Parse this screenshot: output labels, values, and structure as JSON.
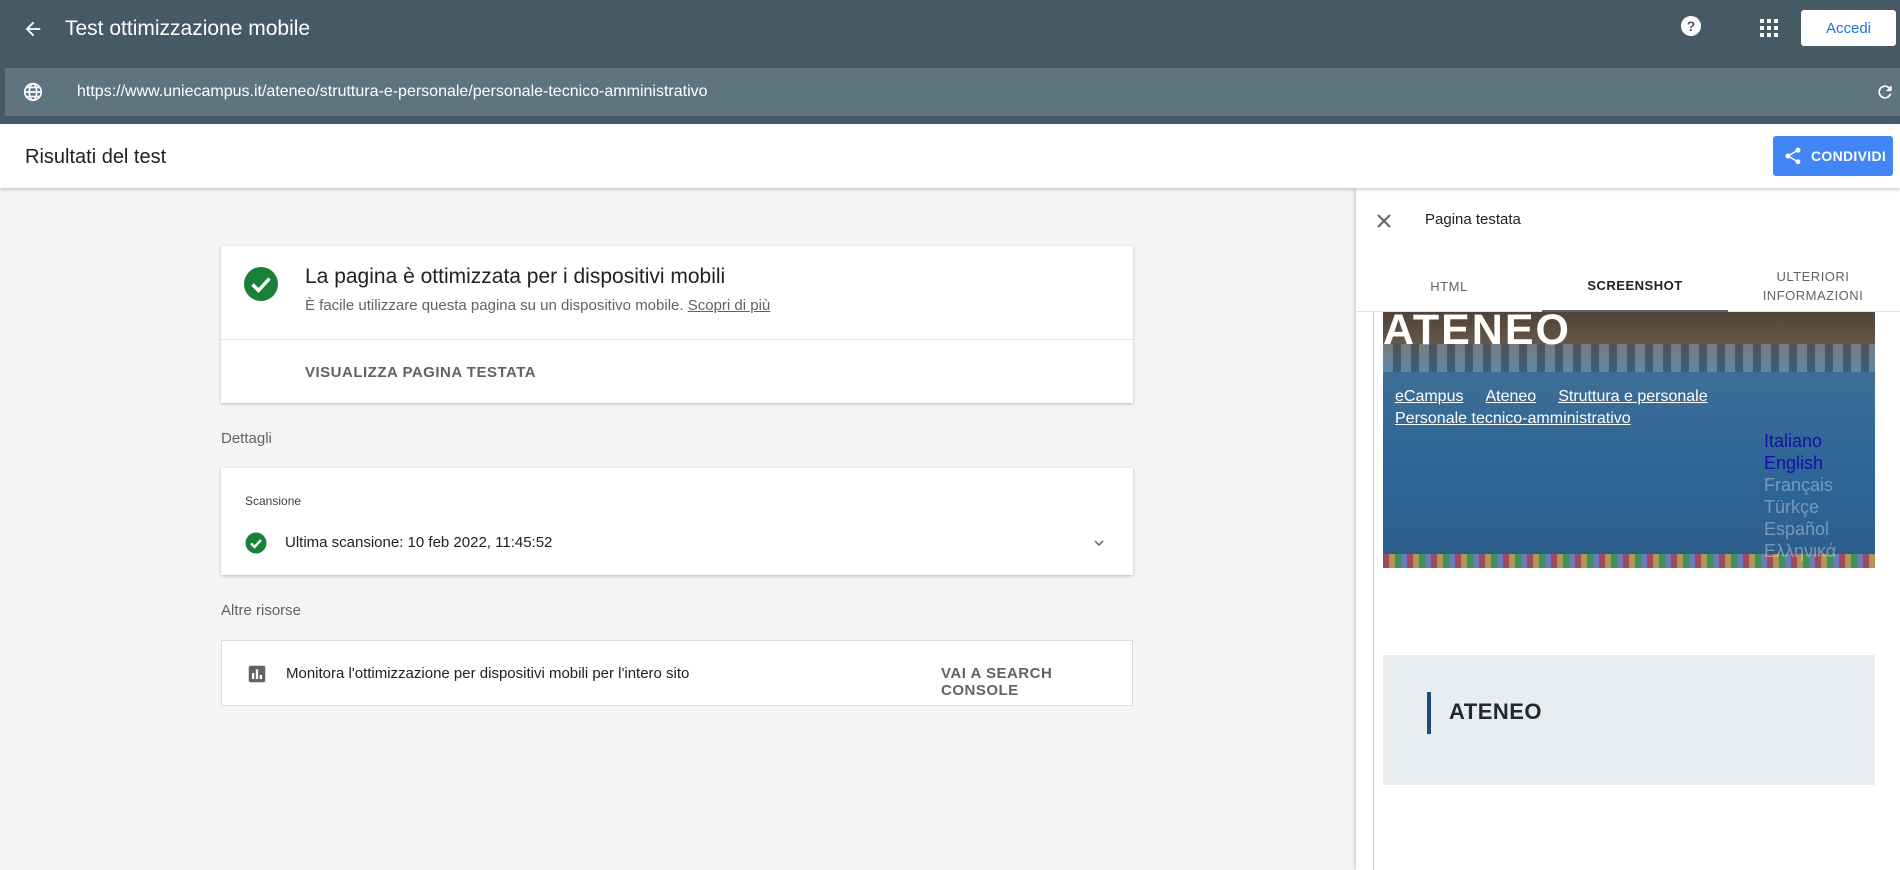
{
  "appbar": {
    "title": "Test ottimizzazione mobile",
    "login_label": "Accedi",
    "url": "https://www.uniecampus.it/ateneo/struttura-e-personale/personale-tecnico-amministrativo"
  },
  "results": {
    "title": "Risultati del test",
    "share_label": "CONDIVIDI"
  },
  "main": {
    "heading": "La pagina è ottimizzata per i dispositivi mobili",
    "subtext": "È facile utilizzare questa pagina su un dispositivo mobile.",
    "learn_more": "Scopri di più",
    "view_page": "VISUALIZZA PAGINA TESTATA",
    "details_label": "Dettagli",
    "scan_label": "Scansione",
    "scan_text": "Ultima scansione: 10 feb 2022, 11:45:52",
    "resources_label": "Altre risorse",
    "resource_text": "Monitora l'ottimizzazione per dispositivi mobili per l'intero sito",
    "resource_link": "VAI A SEARCH CONSOLE"
  },
  "panel": {
    "title": "Pagina testata",
    "tabs": [
      {
        "label": "HTML"
      },
      {
        "label": "SCREENSHOT"
      },
      {
        "label": "ULTERIORI INFORMAZIONI"
      }
    ],
    "screenshot": {
      "hero_title": "ATENEO",
      "breadcrumbs": [
        "eCampus",
        "Ateneo",
        "Struttura e personale",
        "Personale tecnico-amministrativo"
      ],
      "languages": [
        "Italiano",
        "English",
        "Français",
        "Türkçe",
        "Español",
        "Ελληνικά"
      ],
      "section_title": "ATENEO"
    }
  },
  "colors": {
    "appbar": "#455a64",
    "urlbar": "#5e7580",
    "accent": "#4285f4",
    "success": "#188038"
  }
}
